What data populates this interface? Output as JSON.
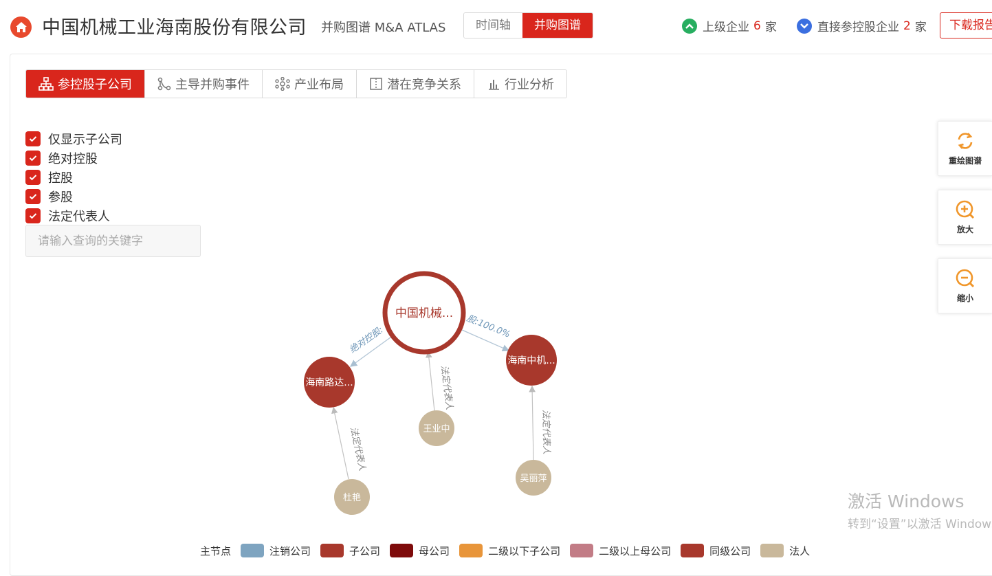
{
  "header": {
    "company_name": "中国机械工业海南股份有限公司",
    "subtitle": "并购图谱 M&A ATLAS",
    "view_toggle": [
      {
        "label": "时间轴",
        "active": false
      },
      {
        "label": "并购图谱",
        "active": true
      }
    ],
    "upper_stat": {
      "prefix": "上级企业",
      "count": "6",
      "unit": "家",
      "icon": "chevron-up-icon",
      "color": "#27ae60"
    },
    "direct_stat": {
      "prefix": "直接参控股企业",
      "count": "2",
      "unit": "家",
      "icon": "chevron-down-icon",
      "color": "#3b6fe0"
    },
    "download_label": "下载报告"
  },
  "tabs": [
    {
      "label": "参控股子公司",
      "icon": "org-chart-icon",
      "active": true
    },
    {
      "label": "主导并购事件",
      "icon": "branch-icon",
      "active": false
    },
    {
      "label": "产业布局",
      "icon": "network-icon",
      "active": false
    },
    {
      "label": "潜在竞争关系",
      "icon": "split-icon",
      "active": false
    },
    {
      "label": "行业分析",
      "icon": "bar-chart-icon",
      "active": false
    }
  ],
  "filters": [
    {
      "label": "仅显示子公司",
      "checked": true
    },
    {
      "label": "绝对控股",
      "checked": true
    },
    {
      "label": "控股",
      "checked": true
    },
    {
      "label": "参股",
      "checked": true
    },
    {
      "label": "法定代表人",
      "checked": true
    }
  ],
  "search": {
    "placeholder": "请输入查询的关键字",
    "value": ""
  },
  "tools": [
    {
      "label": "重绘图谱",
      "icon": "refresh-icon"
    },
    {
      "label": "放大",
      "icon": "zoom-in-icon"
    },
    {
      "label": "缩小",
      "icon": "zoom-out-icon"
    }
  ],
  "graph": {
    "nodes": {
      "main": {
        "label": "中国机械..."
      },
      "sub1": {
        "label": "海南路达..."
      },
      "sub2": {
        "label": "海南中机..."
      },
      "person1": {
        "label": "王业中"
      },
      "person2": {
        "label": "杜艳"
      },
      "person3": {
        "label": "吴丽萍"
      }
    },
    "edges": {
      "main_sub1": "绝对控股:",
      "main_sub2": "股:100.0%",
      "person1_main": "法定代表人",
      "person2_sub1": "法定代表人",
      "person3_sub2": "法定代表人"
    }
  },
  "colors": {
    "accent": "#d9261c",
    "main_ring": "#a8382c",
    "subsidiary": "#a8382c",
    "person": "#c9b89b",
    "edge": "#b3c6d6",
    "edge_label": "#6f97b8"
  },
  "legend": {
    "main_label": "主节点",
    "items": [
      {
        "label": "注销公司",
        "color": "#7ea4c0"
      },
      {
        "label": "子公司",
        "color": "#a8382c"
      },
      {
        "label": "母公司",
        "color": "#7e0b0b"
      },
      {
        "label": "二级以下子公司",
        "color": "#e8953a"
      },
      {
        "label": "二级以上母公司",
        "color": "#c27c86"
      },
      {
        "label": "同级公司",
        "color": "#a8382c"
      },
      {
        "label": "法人",
        "color": "#c9b89b"
      }
    ]
  },
  "watermark": {
    "line1": "激活 Windows",
    "line2": "转到“设置”以激活 Windows。"
  }
}
